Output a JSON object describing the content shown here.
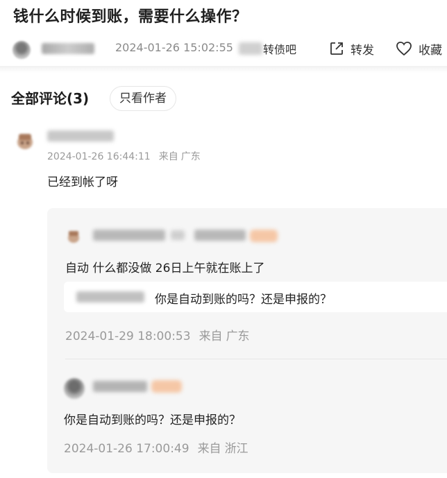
{
  "post": {
    "title": "钱什么时候到账，需要什么操作？",
    "date": "2024-01-26 15:02:55",
    "forum": "转债吧",
    "share_label": "转发",
    "favorite_label": "收藏"
  },
  "comments_section": {
    "heading": "全部评论(3)",
    "author_only_label": "只看作者"
  },
  "comment": {
    "date": "2024-01-26 16:44:11",
    "location_label": "来自",
    "location": "广东",
    "text": "已经到帐了呀"
  },
  "replies": [
    {
      "text": "自动 什么都没做 26日上午就在账上了",
      "quote": "你是自动到账的吗？还是申报的？",
      "date": "2024-01-29 18:00:53",
      "location_label": "来自",
      "location": "广东"
    },
    {
      "text": "你是自动到账的吗？还是申报的？",
      "date": "2024-01-26 17:00:49",
      "location_label": "来自",
      "location": "浙江"
    }
  ]
}
